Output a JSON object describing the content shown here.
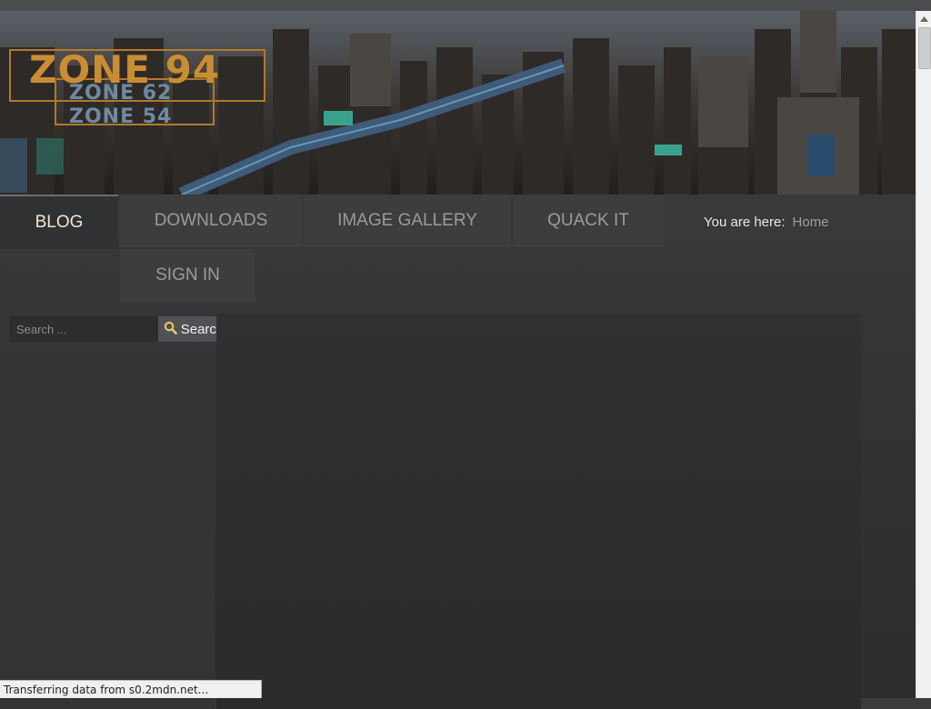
{
  "logo": {
    "main": "ZONE 94",
    "sub1": "ZONE 62",
    "sub2": "ZONE 54"
  },
  "nav": {
    "items": [
      {
        "label": "BLOG",
        "active": true
      },
      {
        "label": "DOWNLOADS"
      },
      {
        "label": "IMAGE GALLERY"
      },
      {
        "label": "QUACK IT"
      },
      {
        "label": "SIGN IN"
      }
    ]
  },
  "breadcrumb": {
    "prefix": "You are here:",
    "home": "Home"
  },
  "search": {
    "placeholder": "Search ...",
    "value": "",
    "button_label": "Search",
    "icon": "search-icon"
  },
  "status_bar": {
    "text": "Transferring data from s0.2mdn.net..."
  },
  "colors": {
    "accent": "#c98d35",
    "logo_secondary": "#6f8aa0",
    "active_nav_text": "#f0e7cf"
  }
}
